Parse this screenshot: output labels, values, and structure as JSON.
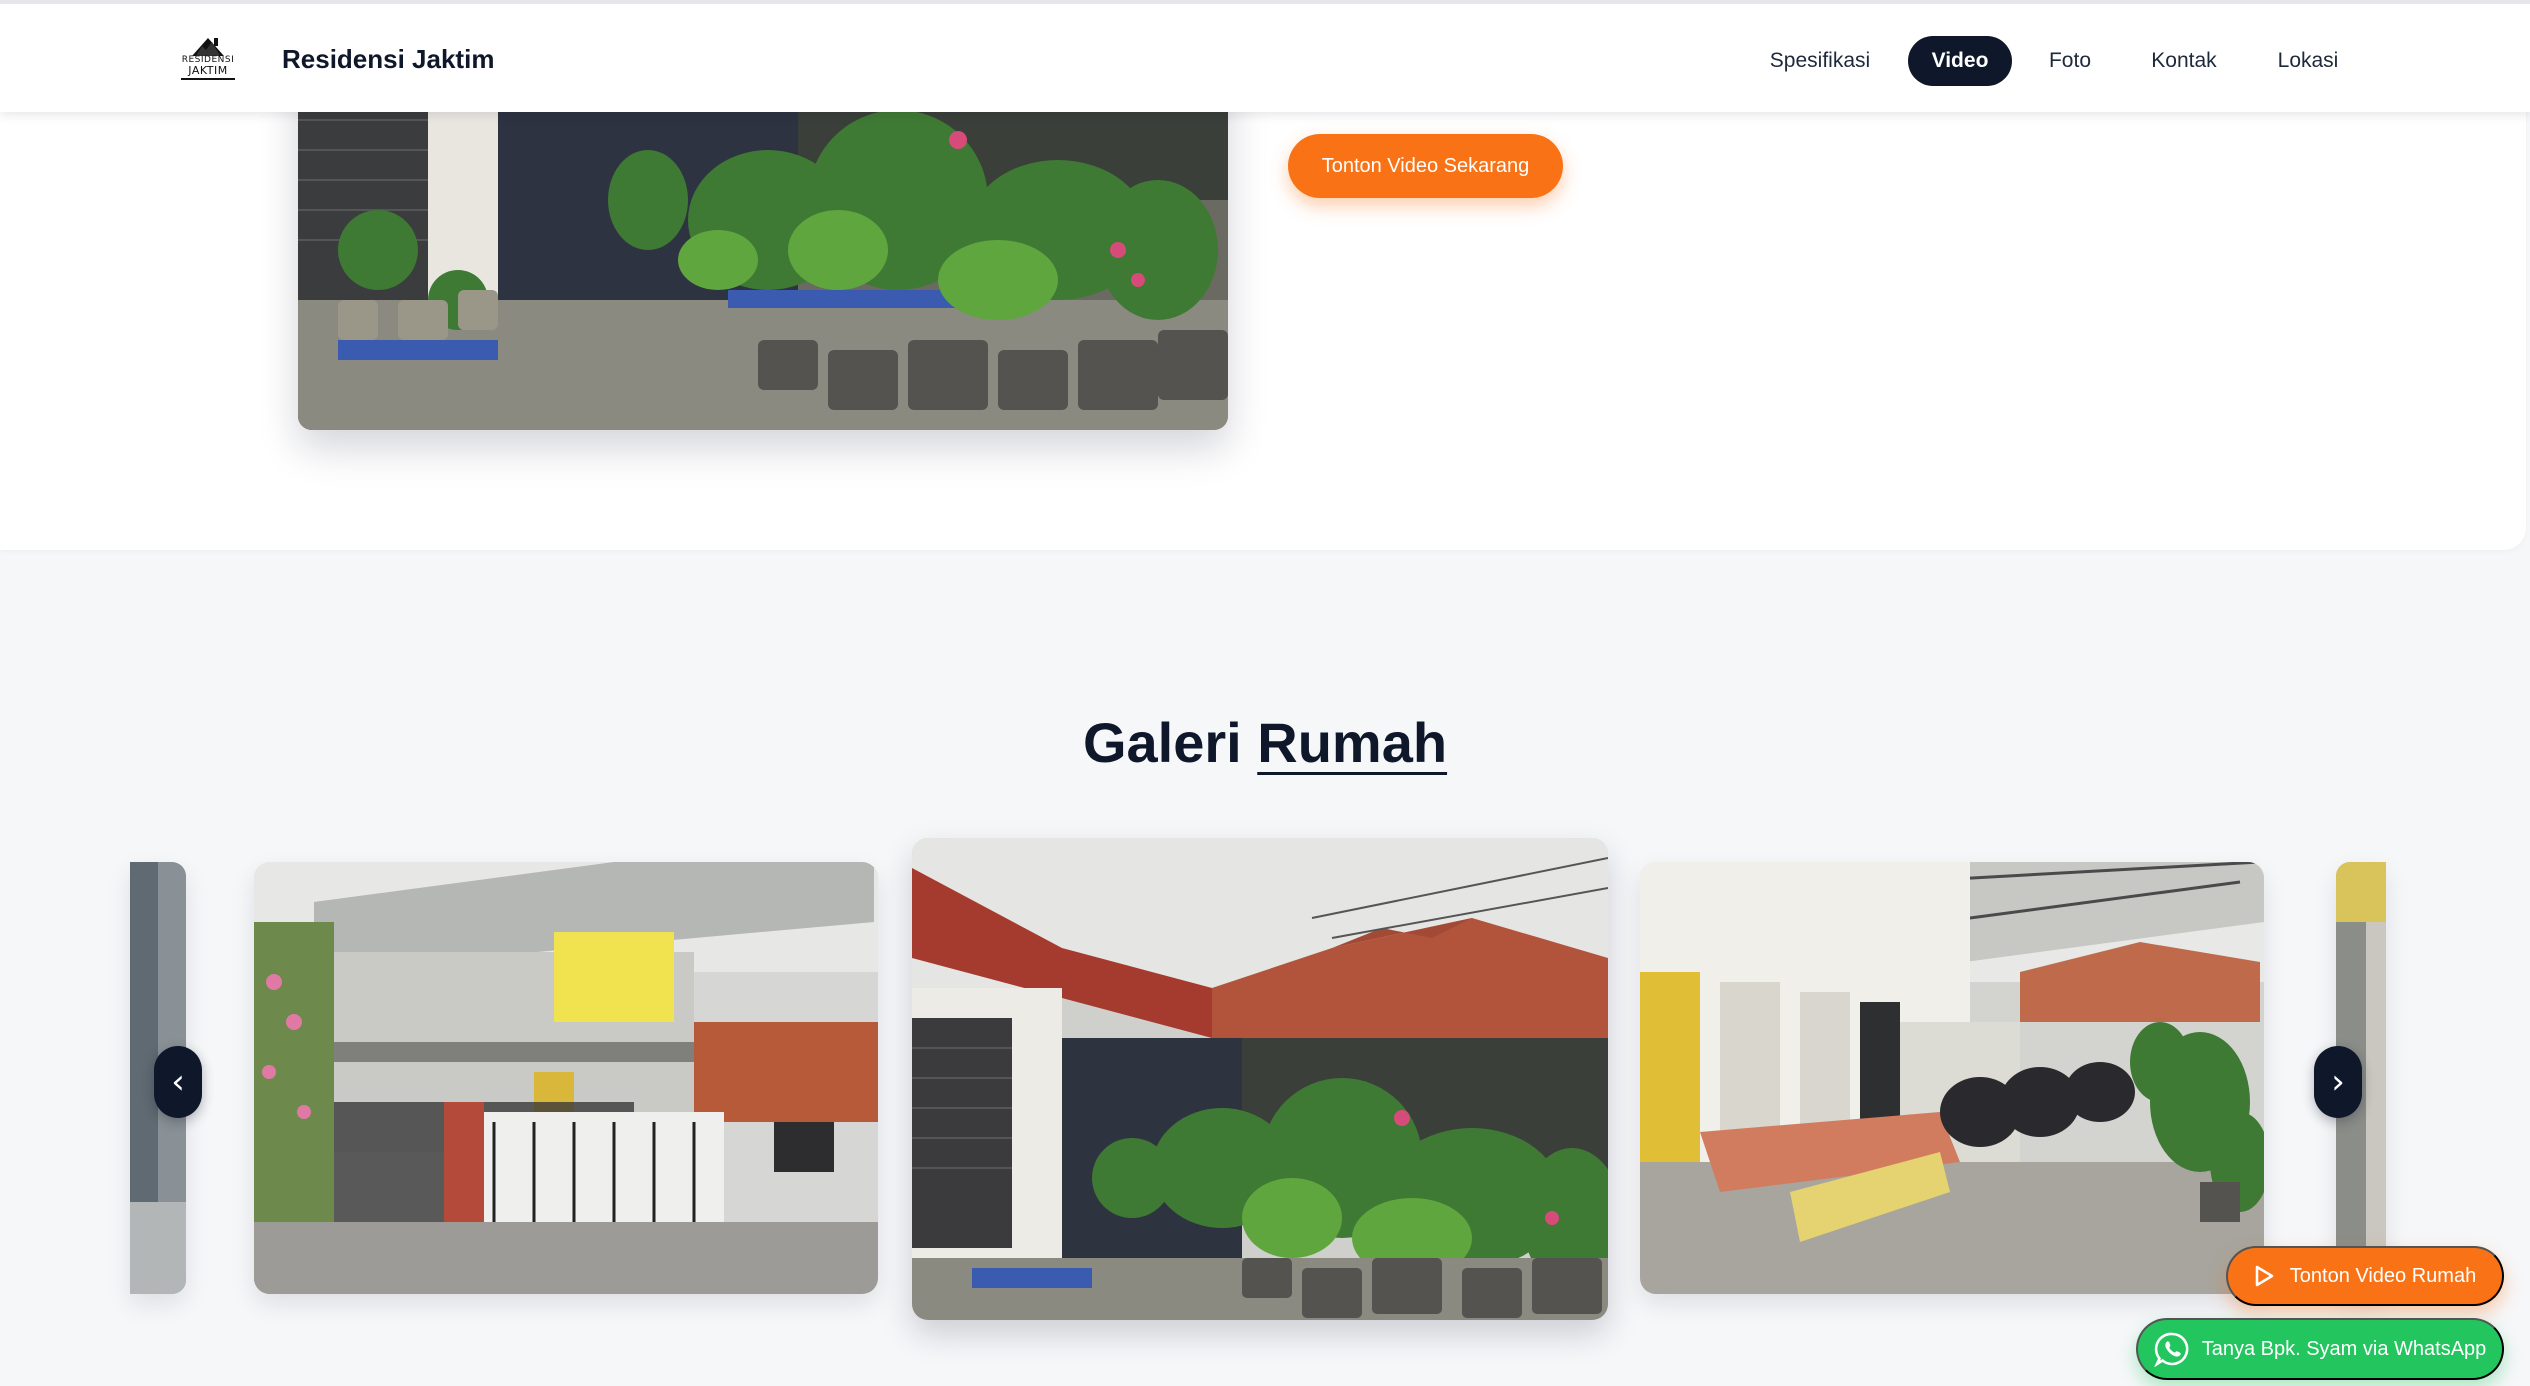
{
  "header": {
    "logo_line1": "RESIDENSI",
    "logo_line2": "JAKTIM",
    "brand": "Residensi Jaktim",
    "nav": [
      "Spesifikasi",
      "Video",
      "Foto",
      "Kontak",
      "Lokasi"
    ],
    "active_nav": "Video"
  },
  "video_section": {
    "watch_button": "Tonton Video Sekarang"
  },
  "gallery": {
    "title_bold": "Galeri",
    "title_underlined": "Rumah",
    "prev_label": "‹",
    "next_label": "›"
  },
  "floating": {
    "video_button": "Tonton Video Rumah",
    "whatsapp_button": "Tanya Bpk. Syam via WhatsApp"
  },
  "colors": {
    "primary_dark": "#0f172a",
    "accent_orange": "#f97316",
    "whatsapp_green": "#22c55e"
  }
}
